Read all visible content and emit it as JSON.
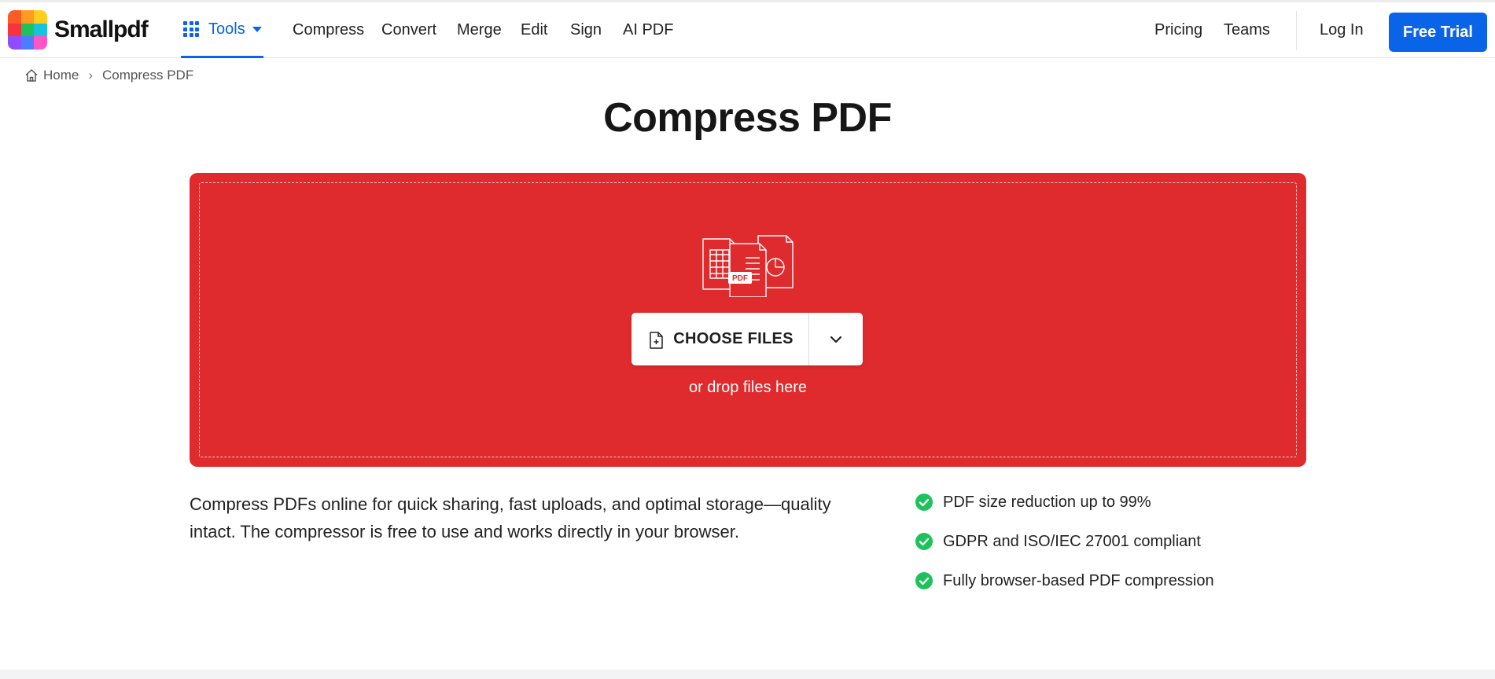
{
  "brand": {
    "name": "Smallpdf",
    "logo_colors": [
      "#f95c24",
      "#ff9a22",
      "#ffcd1c",
      "#f8333c",
      "#1ec25c",
      "#17c1e0",
      "#8f4dff",
      "#4c7cff",
      "#ff56c7"
    ]
  },
  "nav": {
    "tools_label": "Tools",
    "links": [
      "Compress",
      "Convert",
      "Merge",
      "Edit",
      "Sign",
      "AI PDF"
    ],
    "right_links": [
      "Pricing",
      "Teams"
    ],
    "login_label": "Log In",
    "cta_label": "Free Trial"
  },
  "breadcrumb": {
    "home": "Home",
    "separator": "›",
    "current": "Compress PDF"
  },
  "page_title": "Compress PDF",
  "dropzone": {
    "illustration_badge": "PDF",
    "choose_label": "CHOOSE FILES",
    "drop_hint": "or drop files here"
  },
  "description": "Compress PDFs online for quick sharing, fast uploads, and optimal storage—quality intact. The compressor is free to use and works directly in your browser.",
  "features": [
    "PDF size reduction up to 99%",
    "GDPR and ISO/IEC 27001 compliant",
    "Fully browser-based PDF compression"
  ],
  "colors": {
    "accent_blue": "#0a64e8",
    "dropzone_red": "#df2b2d",
    "check_green": "#1ec25c"
  },
  "icons": {
    "tools": "grid-icon",
    "home": "home-icon",
    "choose": "file-plus-icon",
    "more": "chevron-down-icon",
    "feature": "check-circle-icon"
  }
}
